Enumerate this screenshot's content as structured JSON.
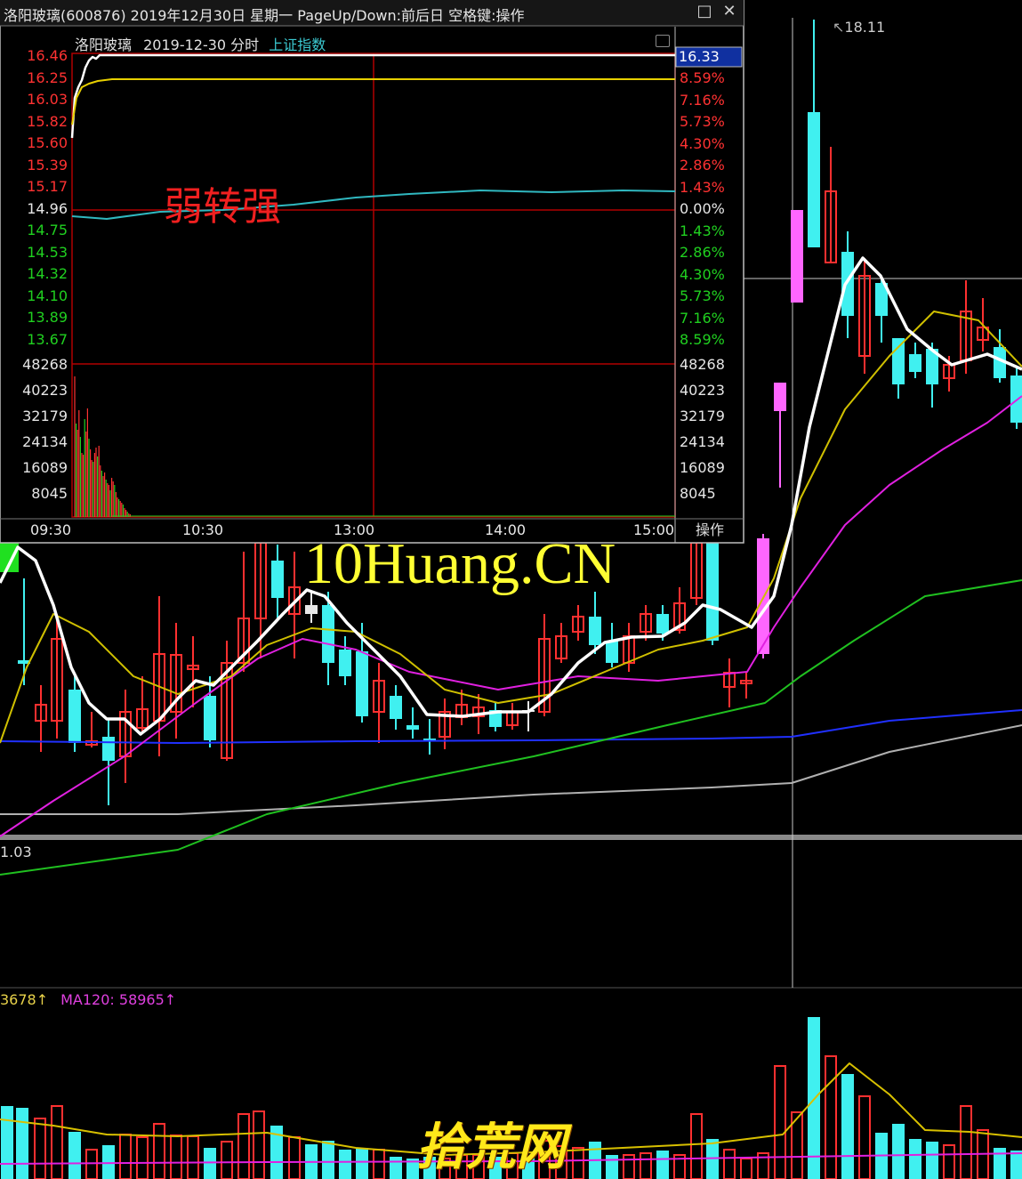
{
  "window": {
    "title": "洛阳玻璃(600876) 2019年12月30日 星期一 PageUp/Down:前后日 空格键:操作",
    "maximize_icon": "maximize-icon",
    "close_icon": "close-icon"
  },
  "intraday": {
    "stock_name": "洛阳玻璃",
    "date_label": "2019-12-30 分时",
    "index_link": "上证指数",
    "current_price_badge": "16.33",
    "annotation": "弱转强",
    "operate_button": "操作",
    "price_labels_left": [
      "16.46",
      "16.25",
      "16.03",
      "15.82",
      "15.60",
      "15.39",
      "15.17",
      "14.96",
      "14.75",
      "14.53",
      "14.32",
      "14.10",
      "13.89",
      "13.67"
    ],
    "pct_labels_right": [
      "8.59%",
      "7.16%",
      "5.73%",
      "4.30%",
      "2.86%",
      "1.43%",
      "0.00%",
      "1.43%",
      "2.86%",
      "4.30%",
      "5.73%",
      "7.16%",
      "8.59%"
    ],
    "volume_labels": [
      "48268",
      "40223",
      "32179",
      "24134",
      "16089",
      "8045"
    ],
    "time_labels": [
      "09:30",
      "10:30",
      "13:00",
      "14:00",
      "15:00"
    ],
    "colors": {
      "up": "#ff3232",
      "down": "#20d020",
      "flat": "#e6e6e6",
      "grid": "#b00000"
    }
  },
  "daily": {
    "high_label": "18.11",
    "indicator_value": "1.03",
    "volume_ma_label": "3678",
    "ma120_label": "MA120: 58965",
    "watermark": "10Huang.CN",
    "site_mark": "拾荒网",
    "colors": {
      "up": "#ff3030",
      "down": "#40f0f0",
      "limit": "#ff66ff"
    }
  }
}
